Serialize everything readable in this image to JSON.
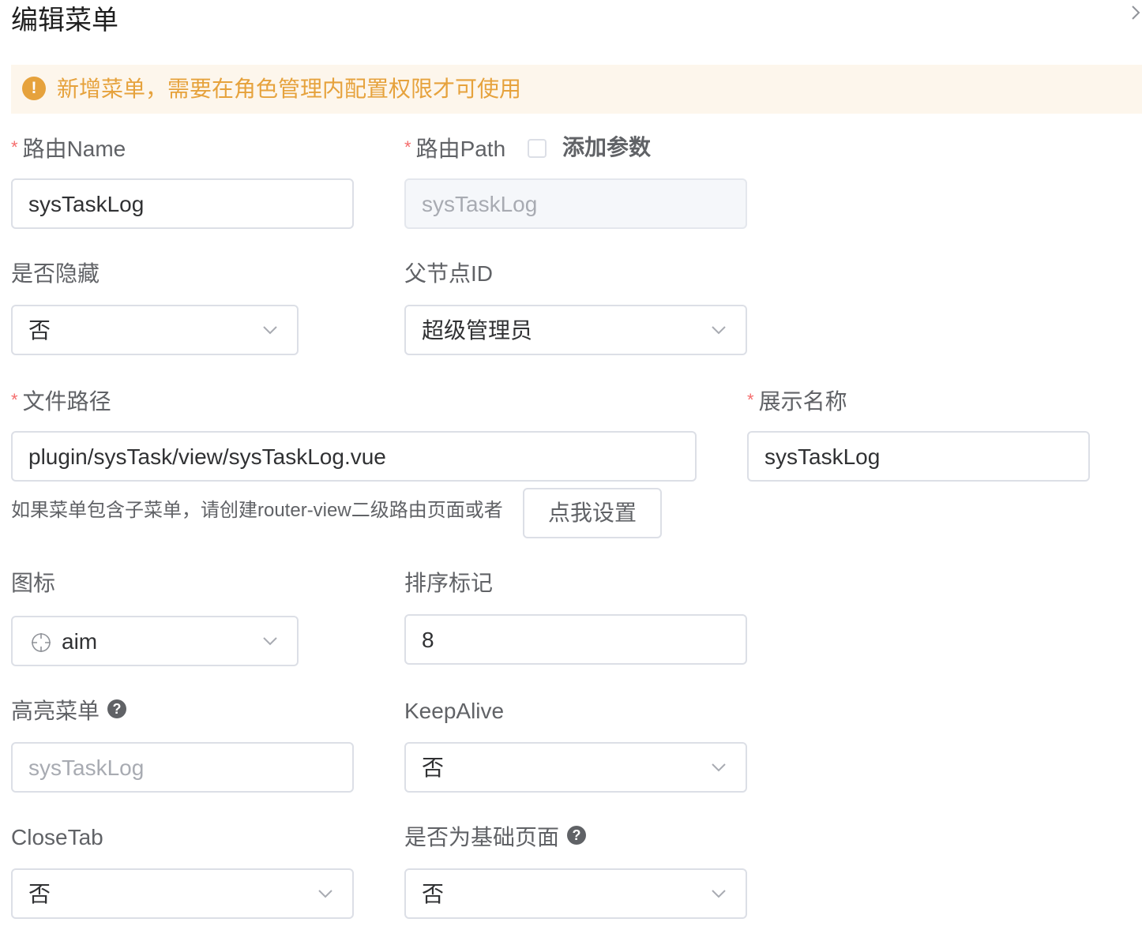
{
  "dialog": {
    "title": "编辑菜单",
    "close_icon": "chevron-right-icon"
  },
  "alert": {
    "icon": "warning-icon",
    "icon_glyph": "!",
    "text": "新增菜单，需要在角色管理内配置权限才可使用",
    "color": "#e6a23c"
  },
  "form": {
    "route_name": {
      "label": "路由Name",
      "required_mark": "*",
      "value": "sysTaskLog"
    },
    "route_path": {
      "label": "路由Path",
      "required_mark": "*",
      "value": "sysTaskLog",
      "checkbox_label": "添加参数",
      "checked": false
    },
    "hidden": {
      "label": "是否隐藏",
      "value": "否"
    },
    "parent_id": {
      "label": "父节点ID",
      "value": "超级管理员"
    },
    "file_path": {
      "label": "文件路径",
      "required_mark": "*",
      "value": "plugin/sysTask/view/sysTaskLog.vue",
      "hint": "如果菜单包含子菜单，请创建router-view二级路由页面或者",
      "button": "点我设置"
    },
    "display_name": {
      "label": "展示名称",
      "required_mark": "*",
      "value": "sysTaskLog"
    },
    "icon": {
      "label": "图标",
      "value": "aim",
      "icon": "aim-icon"
    },
    "sort": {
      "label": "排序标记",
      "value": "8"
    },
    "active_menu": {
      "label": "高亮菜单",
      "help_glyph": "?",
      "placeholder": "sysTaskLog"
    },
    "keep_alive": {
      "label": "KeepAlive",
      "value": "否"
    },
    "close_tab": {
      "label": "CloseTab",
      "value": "否"
    },
    "base_page": {
      "label": "是否为基础页面",
      "help_glyph": "?",
      "value": "否"
    }
  }
}
